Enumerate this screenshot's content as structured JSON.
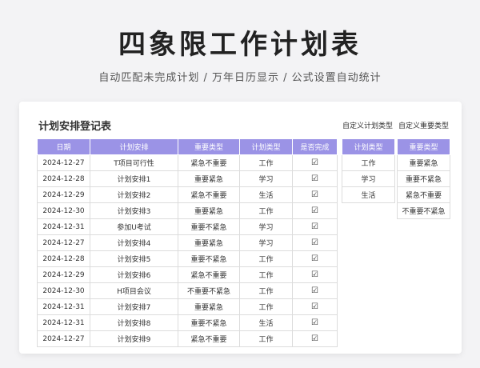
{
  "header": {
    "title": "四象限工作计划表",
    "subtitle": "自动匹配未完成计划 / 万年日历显示 / 公式设置自动统计"
  },
  "card": {
    "title": "计划安排登记表",
    "custom_plan_label": "自定义计划类型",
    "custom_importance_label": "自定义重要类型"
  },
  "main_table": {
    "columns": [
      "日期",
      "计划安排",
      "重要类型",
      "计划类型",
      "是否完成"
    ],
    "rows": [
      [
        "2024-12-27",
        "T项目可行性",
        "紧急不重要",
        "工作",
        "☑"
      ],
      [
        "2024-12-28",
        "计划安排1",
        "重要紧急",
        "学习",
        "☑"
      ],
      [
        "2024-12-29",
        "计划安排2",
        "紧急不重要",
        "生活",
        "☑"
      ],
      [
        "2024-12-30",
        "计划安排3",
        "重要紧急",
        "工作",
        "☑"
      ],
      [
        "2024-12-31",
        "参加U考试",
        "重要不紧急",
        "学习",
        "☑"
      ],
      [
        "2024-12-27",
        "计划安排4",
        "重要紧急",
        "学习",
        "☑"
      ],
      [
        "2024-12-28",
        "计划安排5",
        "重要不紧急",
        "工作",
        "☑"
      ],
      [
        "2024-12-29",
        "计划安排6",
        "紧急不重要",
        "工作",
        "☑"
      ],
      [
        "2024-12-30",
        "H项目会议",
        "不重要不紧急",
        "工作",
        "☑"
      ],
      [
        "2024-12-31",
        "计划安排7",
        "重要紧急",
        "工作",
        "☑"
      ],
      [
        "2024-12-31",
        "计划安排8",
        "重要不紧急",
        "生活",
        "☑"
      ],
      [
        "2024-12-27",
        "计划安排9",
        "紧急不重要",
        "工作",
        "☑"
      ]
    ]
  },
  "plan_type_table": {
    "header": "计划类型",
    "items": [
      "工作",
      "学习",
      "生活"
    ]
  },
  "importance_type_table": {
    "header": "重要类型",
    "items": [
      "重要紧急",
      "重要不紧急",
      "紧急不重要",
      "不重要不紧急"
    ]
  },
  "colors": {
    "header_bg": "#9b93e6",
    "page_bg": "#f3f3f5"
  }
}
